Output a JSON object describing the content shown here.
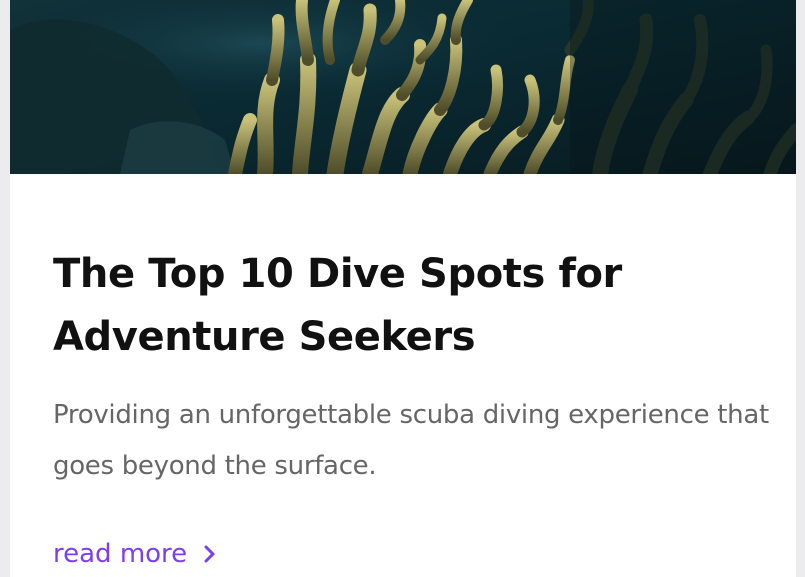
{
  "card": {
    "image_alt": "coral reef underwater",
    "title": "The Top 10 Dive Spots for Adventure Seekers",
    "excerpt": "Providing an unforgettable scuba diving experience that goes beyond the surface.",
    "read_more_label": "read more",
    "read_more_icon": "chevron-right-icon"
  },
  "colors": {
    "accent": "#7b3ff2",
    "title": "#111111",
    "body_text": "#666666",
    "card_bg": "#ffffff",
    "page_bg": "#ececef"
  }
}
